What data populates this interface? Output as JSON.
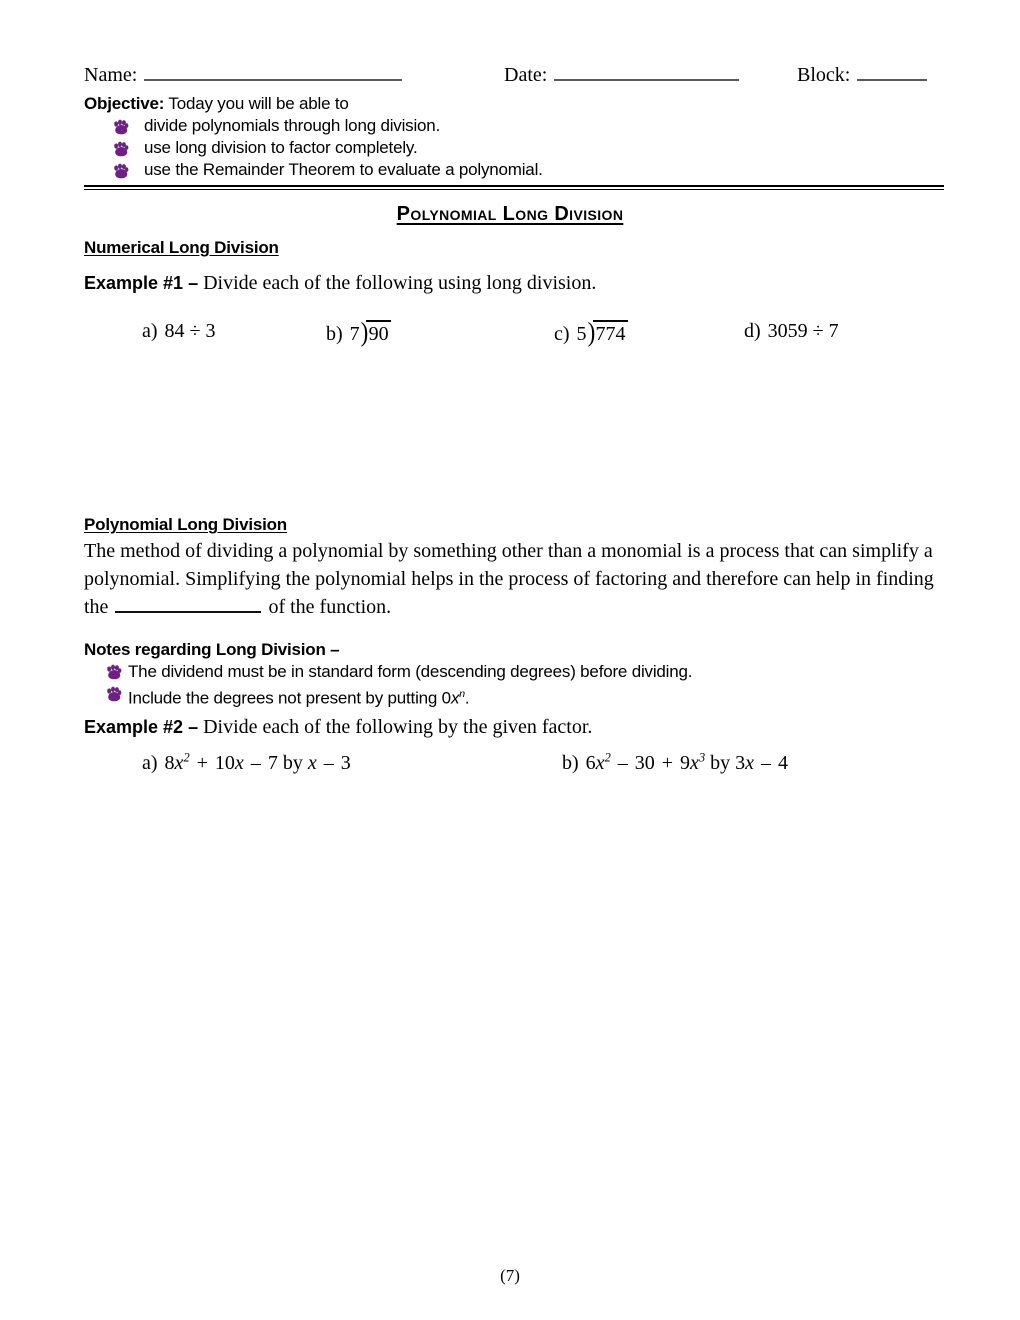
{
  "header": {
    "name_label": "Name:",
    "date_label": "Date:",
    "block_label": "Block:"
  },
  "objective": {
    "label": "Objective:",
    "intro": " Today you will be able to",
    "items": [
      "divide polynomials through long division.",
      "use long division to factor completely.",
      "use the Remainder Theorem to evaluate a polynomial."
    ],
    "bullet_icon": "paw-print-icon",
    "bullet_color": "#6E2185"
  },
  "title": "Polynomial Long Division",
  "sections": {
    "numerical_heading": "Numerical Long Division",
    "polynomial_heading": "Polynomial Long Division"
  },
  "example1": {
    "label": "Example #1 –",
    "prompt": " Divide each of the following using long division.",
    "items": [
      {
        "letter": "a)",
        "kind": "inline",
        "text": "84 ÷ 3"
      },
      {
        "letter": "b)",
        "kind": "longdiv",
        "divisor": "7",
        "dividend": "90"
      },
      {
        "letter": "c)",
        "kind": "longdiv",
        "divisor": "5",
        "dividend": "774"
      },
      {
        "letter": "d)",
        "kind": "inline",
        "text": "3059 ÷ 7"
      }
    ]
  },
  "paragraph": {
    "part1": "The method of dividing a polynomial by something other than a monomial is a process that can simplify a polynomial.  Simplifying the polynomial helps in the process of factoring and therefore can help in finding the ",
    "part2": " of the function."
  },
  "notes": {
    "heading": "Notes regarding Long Division –",
    "items": [
      {
        "text_before": "The dividend must be in standard form (descending degrees) before dividing.",
        "has_sup": false
      },
      {
        "text_before": "Include the degrees not present by putting 0",
        "var": "x",
        "sup": "n",
        "text_after": ".",
        "has_sup": true
      }
    ]
  },
  "example2": {
    "label": "Example #2 –",
    "prompt": " Divide each of the following by the given factor.",
    "items": [
      {
        "letter": "a)",
        "tokens": [
          {
            "t": "num",
            "v": "8"
          },
          {
            "t": "var",
            "v": "x"
          },
          {
            "t": "sup",
            "v": "2"
          },
          {
            "t": "op",
            "v": "+"
          },
          {
            "t": "num",
            "v": "10"
          },
          {
            "t": "var",
            "v": "x"
          },
          {
            "t": "op",
            "v": "–"
          },
          {
            "t": "num",
            "v": "7"
          },
          {
            "t": "word",
            "v": " by "
          },
          {
            "t": "var",
            "v": "x"
          },
          {
            "t": "op",
            "v": "–"
          },
          {
            "t": "num",
            "v": "3"
          }
        ]
      },
      {
        "letter": "b)",
        "tokens": [
          {
            "t": "num",
            "v": "6"
          },
          {
            "t": "var",
            "v": "x"
          },
          {
            "t": "sup",
            "v": "2"
          },
          {
            "t": "op",
            "v": "–"
          },
          {
            "t": "num",
            "v": "30"
          },
          {
            "t": "op",
            "v": "+"
          },
          {
            "t": "num",
            "v": "9"
          },
          {
            "t": "var",
            "v": "x"
          },
          {
            "t": "sup",
            "v": "3"
          },
          {
            "t": "word",
            "v": " by "
          },
          {
            "t": "num",
            "v": "3"
          },
          {
            "t": "var",
            "v": "x"
          },
          {
            "t": "op",
            "v": "–"
          },
          {
            "t": "num",
            "v": "4"
          }
        ]
      }
    ]
  },
  "footer": {
    "page_number": "(7)"
  }
}
